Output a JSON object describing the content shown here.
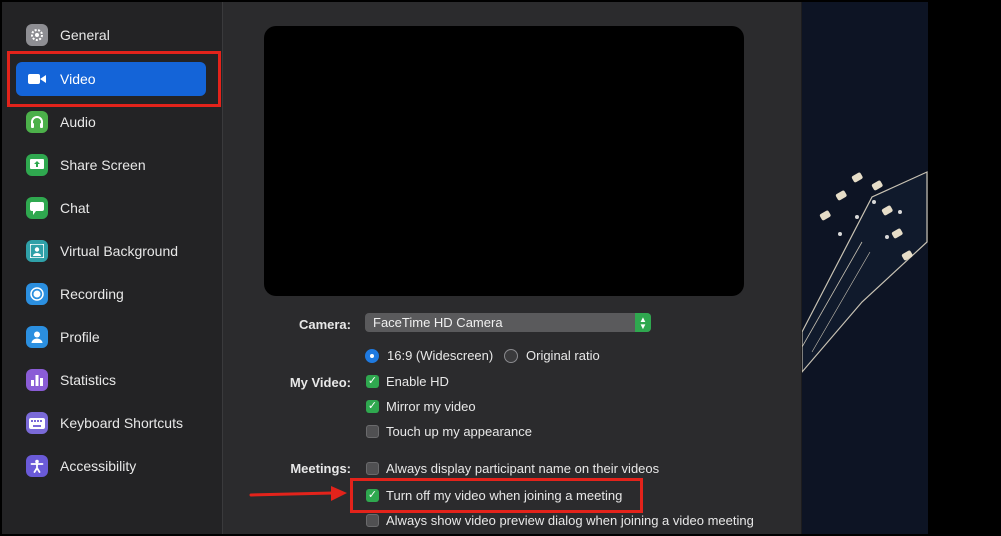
{
  "sidebar": {
    "items": [
      {
        "label": "General",
        "icon": "gear-icon",
        "color": "#8e8e93"
      },
      {
        "label": "Video",
        "icon": "video-camera-icon",
        "color": "#1464d8"
      },
      {
        "label": "Audio",
        "icon": "headphones-icon",
        "color": "#4cb04a"
      },
      {
        "label": "Share Screen",
        "icon": "share-screen-icon",
        "color": "#2fa84f"
      },
      {
        "label": "Chat",
        "icon": "chat-bubble-icon",
        "color": "#2fa84f"
      },
      {
        "label": "Virtual Background",
        "icon": "person-background-icon",
        "color": "#2fa0a8"
      },
      {
        "label": "Recording",
        "icon": "record-icon",
        "color": "#2b8fe0"
      },
      {
        "label": "Profile",
        "icon": "profile-icon",
        "color": "#2b8fe0"
      },
      {
        "label": "Statistics",
        "icon": "bar-chart-icon",
        "color": "#8a5cd6"
      },
      {
        "label": "Keyboard Shortcuts",
        "icon": "keyboard-icon",
        "color": "#7a6ad8"
      },
      {
        "label": "Accessibility",
        "icon": "accessibility-icon",
        "color": "#6a5ad8"
      }
    ],
    "active": "Video"
  },
  "video": {
    "camera_label": "Camera:",
    "camera_value": "FaceTime HD Camera",
    "my_video_label": "My Video:",
    "ratio_options": [
      {
        "label": "16:9 (Widescreen)",
        "selected": true
      },
      {
        "label": "Original ratio",
        "selected": false
      }
    ],
    "my_video_options": [
      {
        "label": "Enable HD",
        "checked": true
      },
      {
        "label": "Mirror my video",
        "checked": true
      },
      {
        "label": "Touch up my appearance",
        "checked": false
      }
    ],
    "meetings_label": "Meetings:",
    "meetings_options": [
      {
        "label": "Always display participant name on their videos",
        "checked": false
      },
      {
        "label": "Turn off my video when joining a meeting",
        "checked": true
      },
      {
        "label": "Always show video preview dialog when joining a video meeting",
        "checked": false
      }
    ]
  },
  "colors": {
    "accent": "#1464d8",
    "highlight": "#e3231b",
    "check": "#2fa84f"
  }
}
